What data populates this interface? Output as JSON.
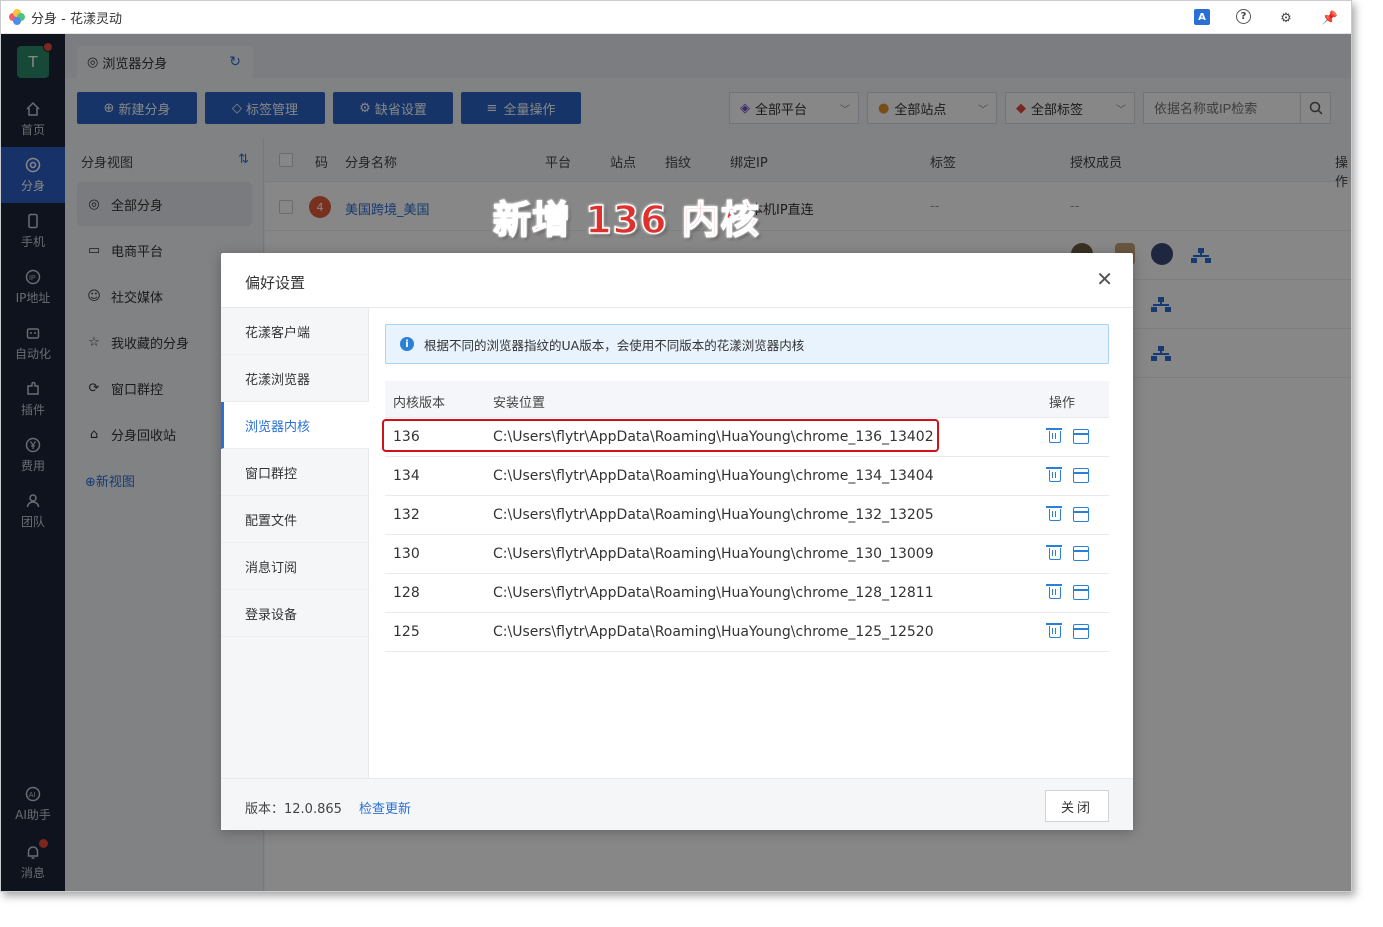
{
  "window": {
    "title": "分身 - 花漾灵动"
  },
  "colors": {
    "brand": "#2b62c3",
    "sidebar_bg": "#1d2438",
    "accent": "#2a6fd6",
    "highlight": "#d0111b"
  },
  "user": {
    "avatar_letter": "T"
  },
  "sidebar": {
    "items": [
      {
        "label": "首页",
        "icon": "home-icon"
      },
      {
        "label": "分身",
        "icon": "chrome-icon"
      },
      {
        "label": "手机",
        "icon": "phone-icon"
      },
      {
        "label": "IP地址",
        "icon": "ip-icon"
      },
      {
        "label": "自动化",
        "icon": "robot-icon"
      },
      {
        "label": "插件",
        "icon": "puzzle-icon"
      },
      {
        "label": "费用",
        "icon": "yen-icon"
      },
      {
        "label": "团队",
        "icon": "team-icon"
      }
    ],
    "bottom": [
      {
        "label": "AI助手",
        "icon": "ai-icon"
      },
      {
        "label": "消息",
        "icon": "bell-icon"
      }
    ]
  },
  "tab": {
    "label": "浏览器分身"
  },
  "toolbar": {
    "new": "新建分身",
    "tags": "标签管理",
    "defaults": "缺省设置",
    "all_ops": "全量操作"
  },
  "filters": {
    "platform": "全部平台",
    "site": "全部站点",
    "tag": "全部标签",
    "search_placeholder": "依据名称或IP检索"
  },
  "views": {
    "header": "分身视图",
    "items": [
      "全部分身",
      "电商平台",
      "社交媒体",
      "我收藏的分身",
      "窗口群控",
      "分身回收站"
    ],
    "new_view": "新视图"
  },
  "table": {
    "headers": [
      "码",
      "分身名称",
      "平台",
      "站点",
      "指纹",
      "绑定IP",
      "标签",
      "授权成员",
      "操作"
    ],
    "row1": {
      "badge": "4",
      "name": "美国跨境_美国",
      "ip": "本机IP直连",
      "tag": "--",
      "members": "--"
    }
  },
  "annotation": "新增 136 内核",
  "dialog": {
    "title": "偏好设置",
    "menu": [
      "花漾客户端",
      "花漾浏览器",
      "浏览器内核",
      "窗口群控",
      "配置文件",
      "消息订阅",
      "登录设备"
    ],
    "info": "根据不同的浏览器指纹的UA版本，会使用不同版本的花漾浏览器内核",
    "columns": [
      "内核版本",
      "安装位置",
      "操作"
    ],
    "kernels": [
      {
        "version": "136",
        "path": "C:\\Users\\flytr\\AppData\\Roaming\\HuaYoung\\chrome_136_13402"
      },
      {
        "version": "134",
        "path": "C:\\Users\\flytr\\AppData\\Roaming\\HuaYoung\\chrome_134_13404"
      },
      {
        "version": "132",
        "path": "C:\\Users\\flytr\\AppData\\Roaming\\HuaYoung\\chrome_132_13205"
      },
      {
        "version": "130",
        "path": "C:\\Users\\flytr\\AppData\\Roaming\\HuaYoung\\chrome_130_13009"
      },
      {
        "version": "128",
        "path": "C:\\Users\\flytr\\AppData\\Roaming\\HuaYoung\\chrome_128_12811"
      },
      {
        "version": "125",
        "path": "C:\\Users\\flytr\\AppData\\Roaming\\HuaYoung\\chrome_125_12520"
      }
    ],
    "version": "版本：12.0.865",
    "check_update": "检查更新",
    "close": "关闭"
  }
}
